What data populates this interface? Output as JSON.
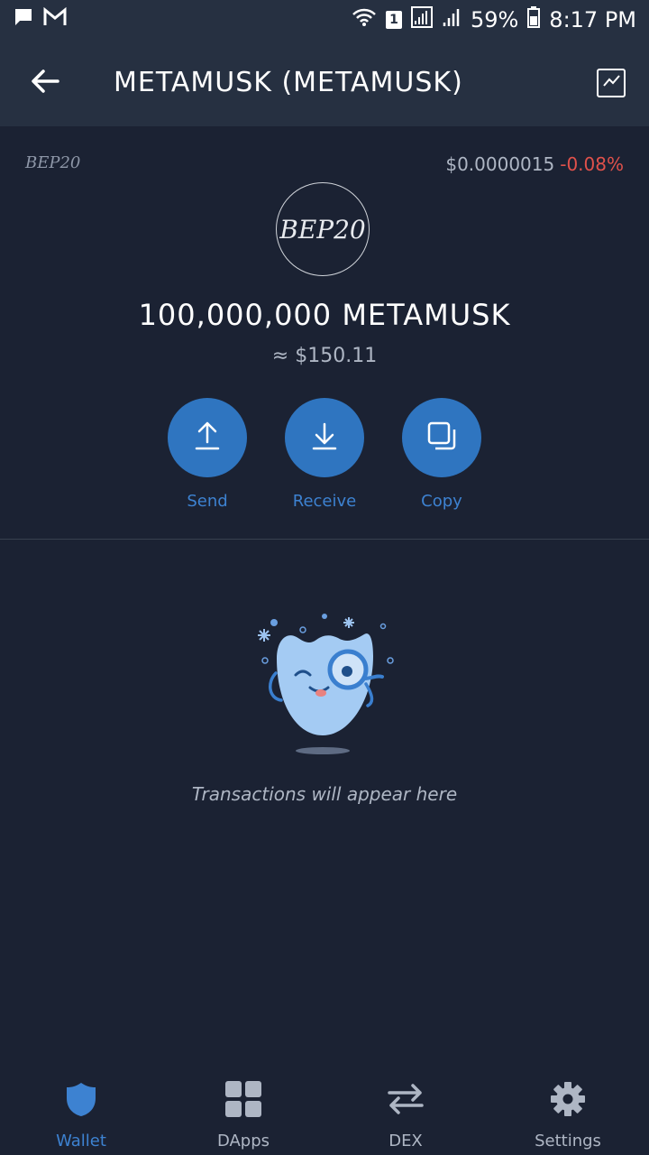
{
  "status_bar": {
    "sim_badge": "1",
    "battery": "59%",
    "time": "8:17 PM",
    "icons": [
      "chat-icon",
      "gmail-icon",
      "wifi-icon",
      "signal-icon",
      "signal-icon",
      "battery-icon"
    ]
  },
  "header": {
    "title": "METAMUSK (METAMUSK)",
    "back_icon": "back-arrow-icon",
    "chart_icon": "price-chart-icon"
  },
  "token": {
    "type_label": "BEP20",
    "logo_text": "BEP20",
    "price": "$0.0000015",
    "change": "-0.08%",
    "balance": "100,000,000 METAMUSK",
    "fiat_value": "≈ $150.11"
  },
  "actions": [
    {
      "label": "Send",
      "icon": "upload-arrow-icon"
    },
    {
      "label": "Receive",
      "icon": "download-arrow-icon"
    },
    {
      "label": "Copy",
      "icon": "copy-icon"
    }
  ],
  "empty_state": {
    "message": "Transactions will appear here",
    "illustration": "mascot-magnifier-illustration"
  },
  "bottom_nav": [
    {
      "label": "Wallet",
      "icon": "shield-icon",
      "active": true
    },
    {
      "label": "DApps",
      "icon": "grid-icon",
      "active": false
    },
    {
      "label": "DEX",
      "icon": "swap-arrows-icon",
      "active": false
    },
    {
      "label": "Settings",
      "icon": "gear-icon",
      "active": false
    }
  ],
  "colors": {
    "background": "#1b2233",
    "app_bar": "#263041",
    "accent": "#2f75c0",
    "negative": "#e0514b"
  }
}
